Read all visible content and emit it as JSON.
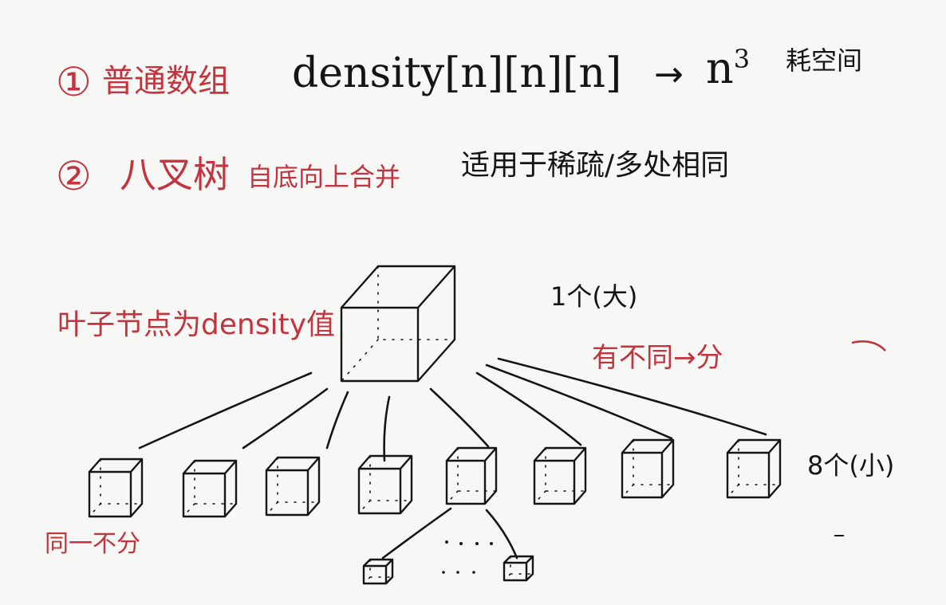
{
  "colors": {
    "ink": "#151515",
    "red": "#c2353f",
    "paper": "#f7f7f5"
  },
  "item1": {
    "number": "①",
    "title": "普通数组",
    "code": "density[n][n][n]",
    "arrow": "→",
    "result_base": "n",
    "result_exp": "3",
    "note": "耗空间"
  },
  "item2": {
    "number": "②",
    "title": "八叉树",
    "method": "自底向上合并",
    "note": "适用于稀疏/多处相同"
  },
  "tree": {
    "leaf_note": "叶子节点为density值",
    "root_label": "1个(大)",
    "split_note": "有不同→分",
    "children_label": "8个(小)",
    "same_note": "同一不分"
  }
}
